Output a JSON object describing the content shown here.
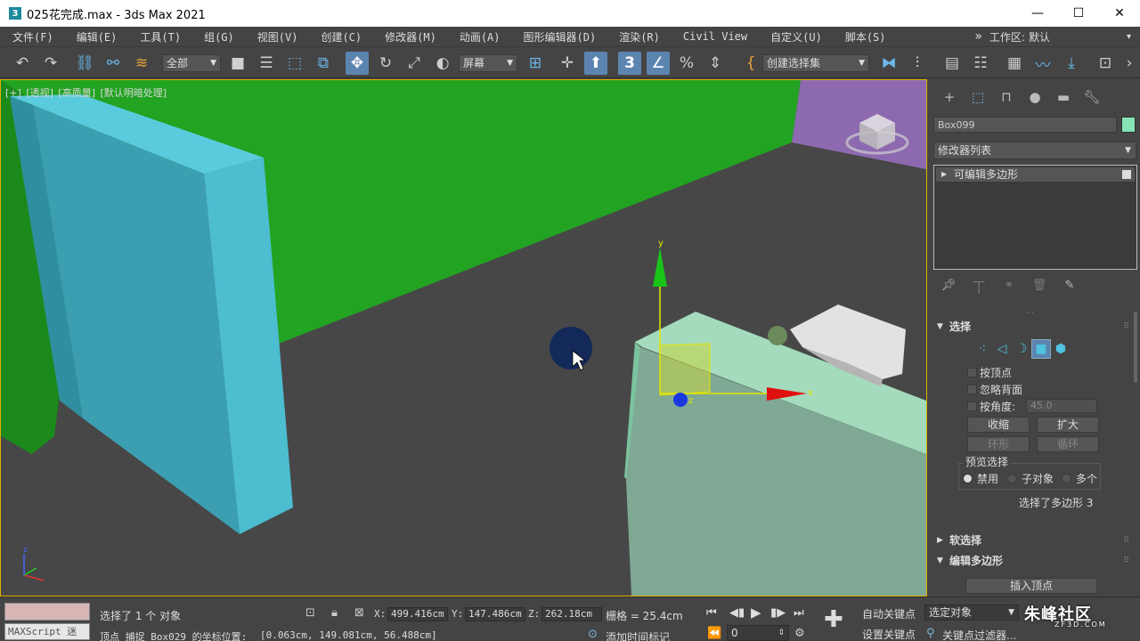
{
  "window": {
    "title": "025花完成.max - 3ds Max 2021",
    "app_icon": "3",
    "minimize_icon": "—",
    "maximize_icon": "☐",
    "close_icon": "✕"
  },
  "menu": {
    "items": [
      "文件(F)",
      "编辑(E)",
      "工具(T)",
      "组(G)",
      "视图(V)",
      "创建(C)",
      "修改器(M)",
      "动画(A)",
      "图形编辑器(D)",
      "渲染(R)",
      "Civil View",
      "自定义(U)",
      "脚本(S)"
    ],
    "more": "»",
    "workspace_label": "工作区:",
    "workspace_value": "默认"
  },
  "toolbar": {
    "selection_filter": "全部",
    "ref_coord": "屏幕",
    "named_selection": "创建选择集",
    "snap_label": "3",
    "percent_snap": "%"
  },
  "viewport": {
    "labels": [
      "[+]",
      "[透视]",
      "[高质量]",
      "[默认明暗处理]"
    ],
    "axis": {
      "x": "x",
      "y": "y",
      "z": "z"
    },
    "colors": {
      "background": "#5a5a5a",
      "floor": "#474747",
      "green_wall": "#22a322",
      "purple_wall": "#8d6ab0",
      "cyan_panel": "#3fb2c6",
      "mint_box": "#9fd6b7",
      "selection_border": "#e0b000"
    }
  },
  "command_panel": {
    "object_name": "Box099",
    "object_color": "#85e2b5",
    "modifier_list": "修改器列表",
    "stack_item": "可编辑多边形",
    "selection_rollout": {
      "title": "选择",
      "by_vertex": "按顶点",
      "ignore_backface": "忽略背面",
      "by_angle": "按角度:",
      "angle_value": "45.0",
      "shrink": "收缩",
      "grow": "扩大",
      "ring": "环形",
      "loop": "循环",
      "preview_title": "预览选择",
      "preview_off": "禁用",
      "preview_subobj": "子对象",
      "preview_multi": "多个",
      "status": "选择了多边形 3"
    },
    "soft_selection": "软选择",
    "edit_polygons": "编辑多边形",
    "insert_vertex": "插入顶点"
  },
  "status": {
    "maxscript": "MAXScript 迷",
    "selected": "选择了 1 个 对象",
    "prompt": "顶点 捕捉 Box029 的坐标位置:",
    "prompt_coords": "[0.063cm, 149.081cm, 56.488cm]",
    "x_label": "X:",
    "x_value": "499.416cm",
    "y_label": "Y:",
    "y_value": "147.486cm",
    "z_label": "Z:",
    "z_value": "262.18cm",
    "grid": "栅格 = 25.4cm",
    "add_time_tag": "添加时间标记",
    "frame": "0",
    "auto_key": "自动关键点",
    "set_key": "设置关键点",
    "selected_obj": "选定对象",
    "key_filters": "关键点过滤器..."
  },
  "watermark": {
    "text": "朱峰社区",
    "sub": "ZF3D.COM"
  }
}
